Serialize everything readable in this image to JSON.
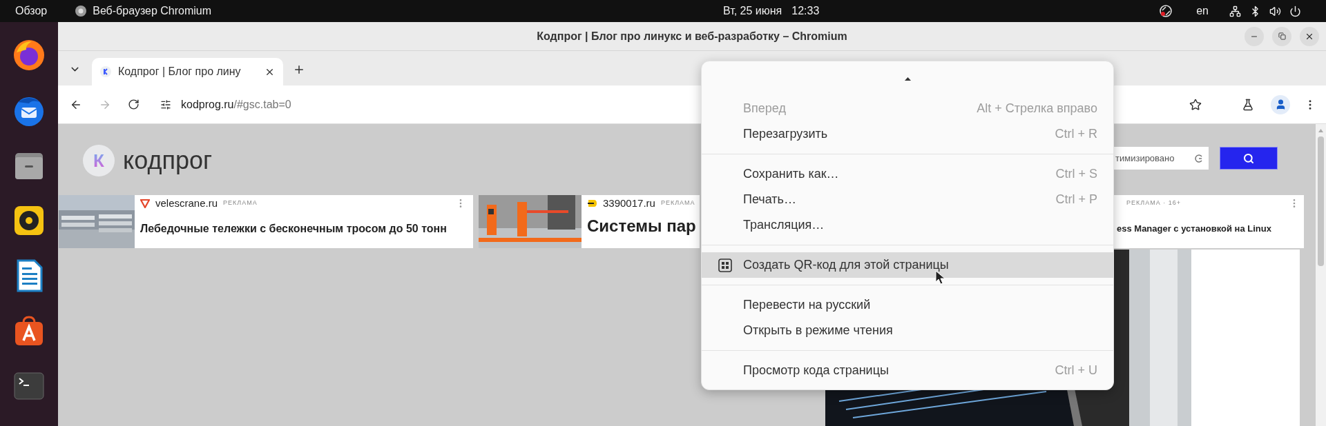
{
  "top_bar": {
    "activities": "Обзор",
    "app_name": "Веб-браузер Chromium",
    "date": "Вт, 25 июня",
    "time": "12:33",
    "keyboard_layout": "en"
  },
  "window": {
    "title": "Кодпрог | Блог про линукс и веб-разработку – Chromium"
  },
  "tabs": [
    {
      "title": "Кодпрог | Блог про лину",
      "selected": true
    }
  ],
  "toolbar": {
    "forward": {
      "disabled": true
    },
    "url_host": "kodprog.ru",
    "url_path": "/#gsc.tab=0"
  },
  "site": {
    "logo_mark": "К",
    "logo_text": "кодпрог",
    "search": {
      "placeholder": "тимизировано"
    }
  },
  "ads": [
    {
      "domain": "velescrane.ru",
      "label": "РЕКЛАМА",
      "title": "Лебедочные тележки с бесконечным тросом до 50 тонн"
    },
    {
      "domain": "3390017.ru",
      "label": "РЕКЛАМА",
      "title": "Системы пар"
    },
    {
      "label": "РЕКЛАМА · 16+",
      "title": "ess Manager с установкой на Linux"
    }
  ],
  "context_menu": {
    "groups": [
      [
        {
          "label": "Вперед",
          "shortcut": "Alt + Стрелка вправо",
          "disabled": true,
          "selected": false
        },
        {
          "label": "Перезагрузить",
          "shortcut": "Ctrl + R",
          "disabled": false,
          "selected": false
        }
      ],
      [
        {
          "label": "Сохранить как…",
          "shortcut": "Ctrl + S",
          "disabled": false,
          "selected": false
        },
        {
          "label": "Печать…",
          "shortcut": "Ctrl + P",
          "disabled": false,
          "selected": false
        },
        {
          "label": "Трансляция…",
          "disabled": false,
          "selected": false
        }
      ],
      [
        {
          "label": "Создать QR-код для этой страницы",
          "kind": "qr",
          "disabled": false,
          "selected": true
        }
      ],
      [
        {
          "label": "Перевести на русский",
          "disabled": false,
          "selected": false
        },
        {
          "label": "Открыть в режиме чтения",
          "disabled": false,
          "selected": false
        }
      ],
      [
        {
          "label": "Просмотр кода страницы",
          "shortcut": "Ctrl + U",
          "disabled": false,
          "selected": false
        }
      ]
    ]
  }
}
